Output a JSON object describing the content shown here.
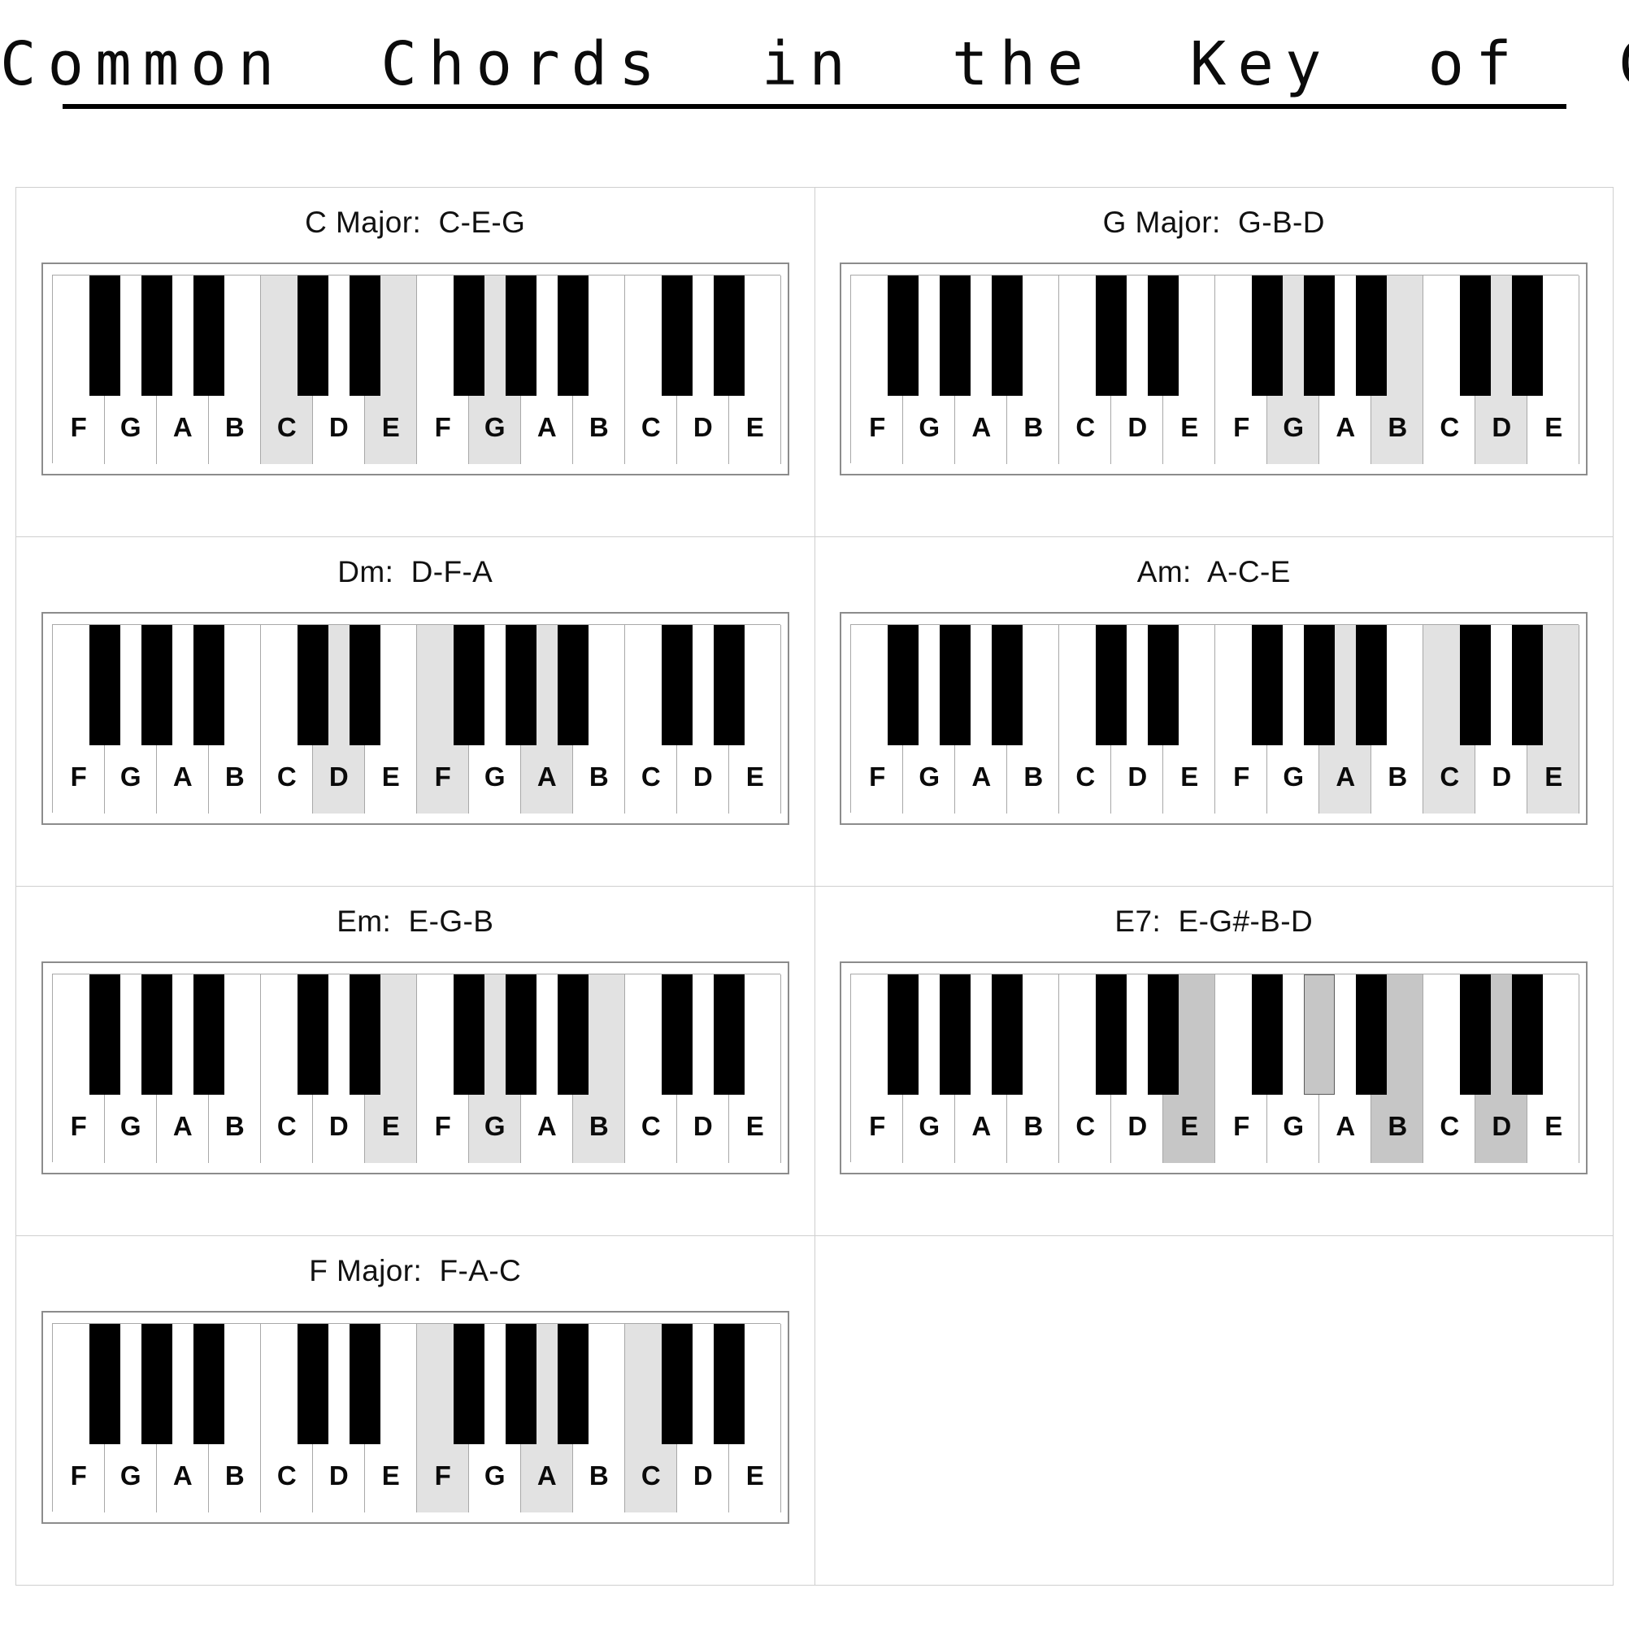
{
  "page": {
    "title": "Common  Chords  in  the  Key  of  C"
  },
  "keyboard": {
    "white_keys": [
      "F",
      "G",
      "A",
      "B",
      "C",
      "D",
      "E",
      "F",
      "G",
      "A",
      "B",
      "C",
      "D",
      "E"
    ],
    "black_key_after_index": [
      0,
      1,
      2,
      4,
      5,
      7,
      8,
      9,
      11,
      12
    ],
    "highlight_color": "#e2e2e2",
    "highlight_strong_color": "#c6c6c6",
    "white_key_color": "#ffffff",
    "black_key_color": "#000000",
    "border_color": "#a8a8a8"
  },
  "chords": [
    {
      "label": "C Major:  C-E-G",
      "name": "C Major",
      "notes": "C-E-G",
      "highlight_white_indices": [
        4,
        6,
        8
      ],
      "highlight_black_after_indices": [],
      "strong": false
    },
    {
      "label": "G Major:  G-B-D",
      "name": "G Major",
      "notes": "G-B-D",
      "highlight_white_indices": [
        8,
        10,
        12
      ],
      "highlight_black_after_indices": [],
      "strong": false
    },
    {
      "label": "Dm:  D-F-A",
      "name": "Dm",
      "notes": "D-F-A",
      "highlight_white_indices": [
        5,
        7,
        9
      ],
      "highlight_black_after_indices": [],
      "strong": false
    },
    {
      "label": "Am:  A-C-E",
      "name": "Am",
      "notes": "A-C-E",
      "highlight_white_indices": [
        9,
        11,
        13
      ],
      "highlight_black_after_indices": [],
      "strong": false
    },
    {
      "label": "Em:  E-G-B",
      "name": "Em",
      "notes": "E-G-B",
      "highlight_white_indices": [
        6,
        8,
        10
      ],
      "highlight_black_after_indices": [],
      "strong": false
    },
    {
      "label": "E7:  E-G#-B-D",
      "name": "E7",
      "notes": "E-G#-B-D",
      "highlight_white_indices": [
        6,
        10,
        12
      ],
      "highlight_black_after_indices": [
        8
      ],
      "strong": true
    },
    {
      "label": "F Major:  F-A-C",
      "name": "F Major",
      "notes": "F-A-C",
      "highlight_white_indices": [
        7,
        9,
        11
      ],
      "highlight_black_after_indices": [],
      "strong": false
    }
  ]
}
